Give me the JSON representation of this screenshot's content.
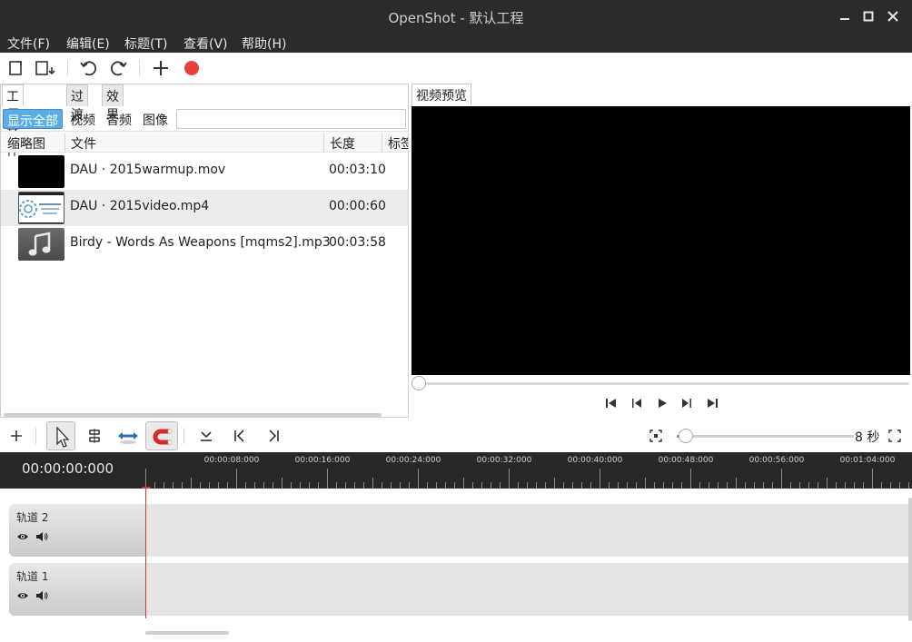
{
  "window": {
    "title": "OpenShot - 默认工程"
  },
  "menubar": [
    {
      "label": "文件(F)"
    },
    {
      "label": "编辑(E)"
    },
    {
      "label": "标题(T)"
    },
    {
      "label": "查看(V)"
    },
    {
      "label": "帮助(H)"
    }
  ],
  "project_panel": {
    "tabs": [
      "工程文件",
      "过渡",
      "效果"
    ],
    "filters": [
      "显示全部",
      "视频",
      "音频",
      "图像"
    ],
    "search": {
      "value": "",
      "placeholder": ""
    },
    "columns": [
      "缩略图",
      "文件",
      "长度",
      "标签"
    ],
    "files": [
      {
        "name": "DAU · 2015warmup.mov",
        "duration": "00:03:10",
        "thumb": "black"
      },
      {
        "name": "DAU · 2015video.mp4",
        "duration": "00:00:60",
        "thumb": "slide"
      },
      {
        "name": "Birdy - Words As Weapons [mqms2].mp3",
        "duration": "00:03:58",
        "thumb": "music"
      }
    ]
  },
  "preview": {
    "tab": "视频预览"
  },
  "timeline": {
    "zoom_label": "8 秒",
    "timecode": "00:00:00:000",
    "ruler_labels": [
      "00:00:08:000",
      "00:00:16:000",
      "00:00:24:000",
      "00:00:32:000",
      "00:00:40:000",
      "00:00:48:000",
      "00:00:56:000",
      "00:01:04:000"
    ],
    "tracks": [
      {
        "name": "轨道 2"
      },
      {
        "name": "轨道 1"
      }
    ]
  },
  "colors": {
    "accent": "#5aaee6",
    "record": "#e8413b",
    "playhead": "#e03030",
    "titlebar": "#2b2b2b"
  },
  "icons": [
    "new-project-icon",
    "save-project-icon",
    "undo-icon",
    "redo-icon",
    "add-file-icon",
    "record-icon",
    "pointer-icon",
    "razor-icon",
    "snap-icon",
    "magnet-icon",
    "jump-start-icon",
    "rewind-icon",
    "play-icon",
    "forward-icon",
    "jump-end-icon"
  ]
}
